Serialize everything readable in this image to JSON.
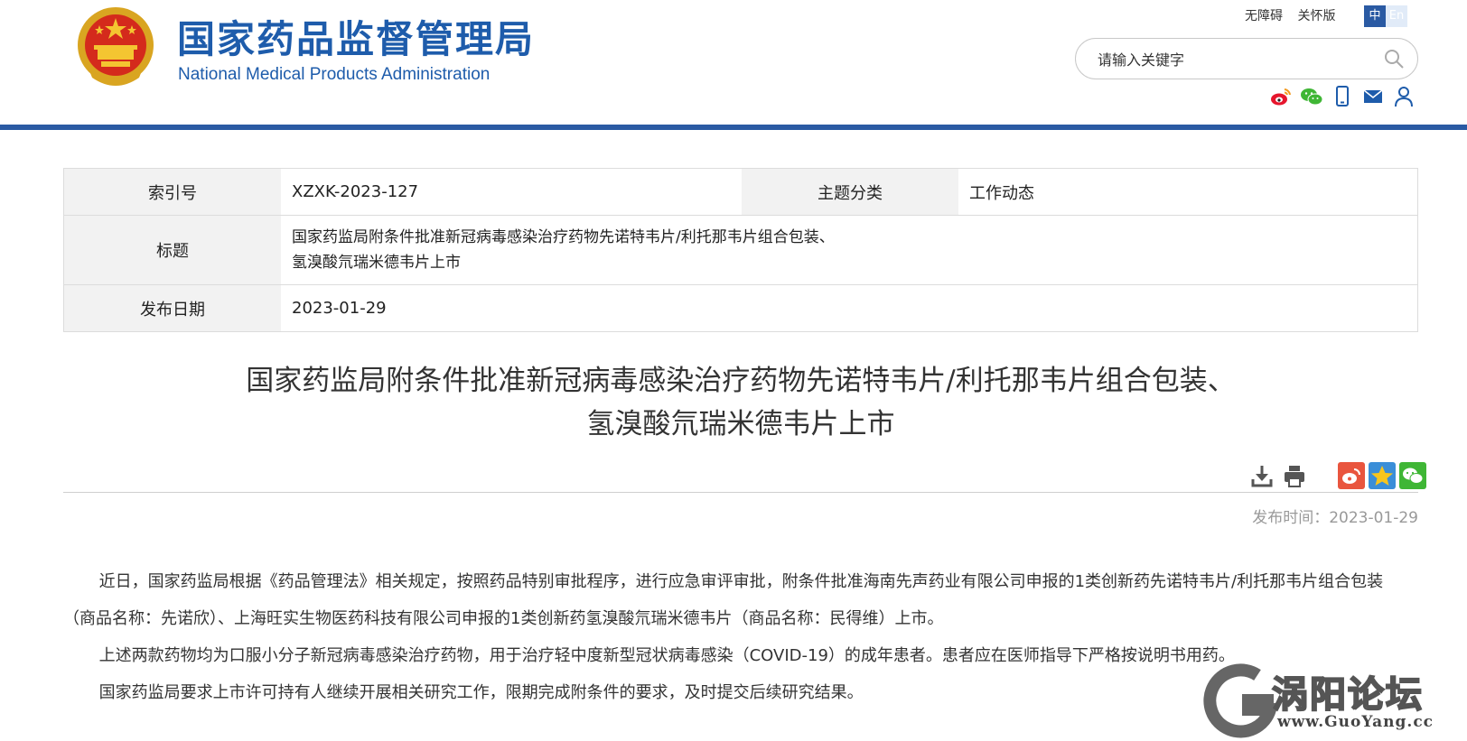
{
  "header": {
    "title_cn": "国家药品监督管理局",
    "title_en": "National Medical Products Administration",
    "top_links": [
      "无障碍",
      "关怀版"
    ],
    "lang_zh": "中",
    "lang_en": "En",
    "search_placeholder": "请输入关键字",
    "brand_color": "#1e5cab",
    "social_icons": [
      "weibo-icon",
      "wechat-icon",
      "mobile-icon",
      "mail-icon",
      "user-icon"
    ]
  },
  "meta": {
    "index_label": "索引号",
    "index_value": "XZXK-2023-127",
    "category_label": "主题分类",
    "category_value": "工作动态",
    "title_label": "标题",
    "title_value_line1": "国家药监局附条件批准新冠病毒感染治疗药物先诺特韦片/利托那韦片组合包装、",
    "title_value_line2": "氢溴酸氘瑞米德韦片上市",
    "date_label": "发布日期",
    "date_value": "2023-01-29"
  },
  "article": {
    "title_line1": "国家药监局附条件批准新冠病毒感染治疗药物先诺特韦片/利托那韦片组合包装、",
    "title_line2": "氢溴酸氘瑞米德韦片上市",
    "publish_time": "发布时间：2023-01-29",
    "paragraphs": [
      "近日，国家药监局根据《药品管理法》相关规定，按照药品特别审批程序，进行应急审评审批，附条件批准海南先声药业有限公司申报的1类创新药先诺特韦片/利托那韦片组合包装（商品名称：先诺欣）、上海旺实生物医药科技有限公司申报的1类创新药氢溴酸氘瑞米德韦片（商品名称：民得维）上市。",
      "上述两款药物均为口服小分子新冠病毒感染治疗药物，用于治疗轻中度新型冠状病毒感染（COVID-19）的成年患者。患者应在医师指导下严格按说明书用药。",
      "国家药监局要求上市许可持有人继续开展相关研究工作，限期完成附条件的要求，及时提交后续研究结果。"
    ]
  },
  "watermark": {
    "name": "涡阳论坛",
    "url": "www.GuoYang.cc"
  }
}
